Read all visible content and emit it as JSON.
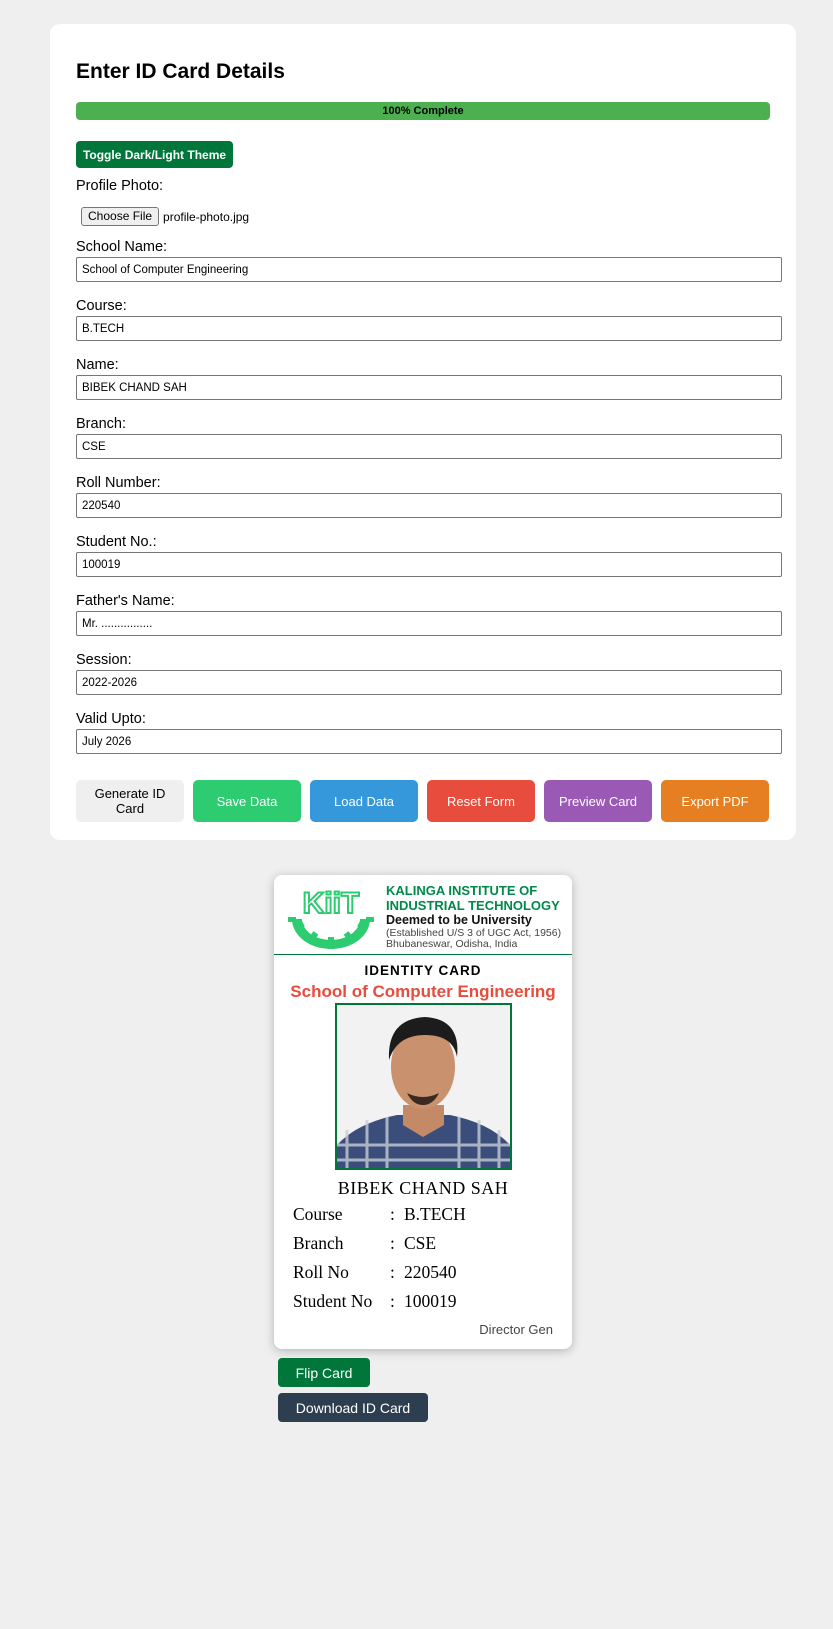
{
  "form": {
    "title": "Enter ID Card Details",
    "progress_text": "100% Complete",
    "progress_percent": 100,
    "theme_toggle_label": "Toggle Dark/Light Theme",
    "photo_label": "Profile Photo:",
    "choose_file_label": "Choose File",
    "file_name": "profile-photo.jpg",
    "fields": {
      "school_name": {
        "label": "School Name:",
        "value": "School of Computer Engineering"
      },
      "course": {
        "label": "Course:",
        "value": "B.TECH"
      },
      "name": {
        "label": "Name:",
        "value": "BIBEK CHAND SAH"
      },
      "branch": {
        "label": "Branch:",
        "value": "CSE"
      },
      "roll_number": {
        "label": "Roll Number:",
        "value": "220540"
      },
      "student_no": {
        "label": "Student No.:",
        "value": "100019"
      },
      "fathers_name": {
        "label": "Father's Name:",
        "value": "Mr. ................"
      },
      "session": {
        "label": "Session:",
        "value": "2022-2026"
      },
      "valid_upto": {
        "label": "Valid Upto:",
        "value": "July 2026"
      }
    },
    "actions": {
      "generate": "Generate ID Card",
      "save": "Save Data",
      "load": "Load Data",
      "reset": "Reset Form",
      "preview": "Preview Card",
      "export": "Export PDF"
    }
  },
  "card": {
    "logo_text": "KiiT",
    "institute_line1": "KALINGA INSTITUTE OF",
    "institute_line2": "INDUSTRIAL TECHNOLOGY",
    "deemed": "Deemed to be University",
    "established": "(Established U/S 3 of UGC Act, 1956)",
    "city": "Bhubaneswar, Odisha, India",
    "title": "IDENTITY CARD",
    "school": "School of Computer Engineering",
    "student_name": "BIBEK CHAND SAH",
    "colon": ":",
    "info": {
      "course": {
        "key": "Course",
        "value": "B.TECH"
      },
      "branch": {
        "key": "Branch",
        "value": "CSE"
      },
      "roll": {
        "key": "Roll No",
        "value": "220540"
      },
      "student_no": {
        "key": "Student No",
        "value": "100019"
      }
    },
    "director": "Director Gen"
  },
  "buttons": {
    "flip": "Flip Card",
    "download": "Download ID Card"
  },
  "colors": {
    "brand_green": "#00763a",
    "progress_green": "#4caf50",
    "school_red": "#e74c3c",
    "save": "#2ecc71",
    "load": "#3498db",
    "reset": "#e74c3c",
    "preview": "#9b59b6",
    "export": "#e67e22",
    "download": "#2c3e50"
  }
}
